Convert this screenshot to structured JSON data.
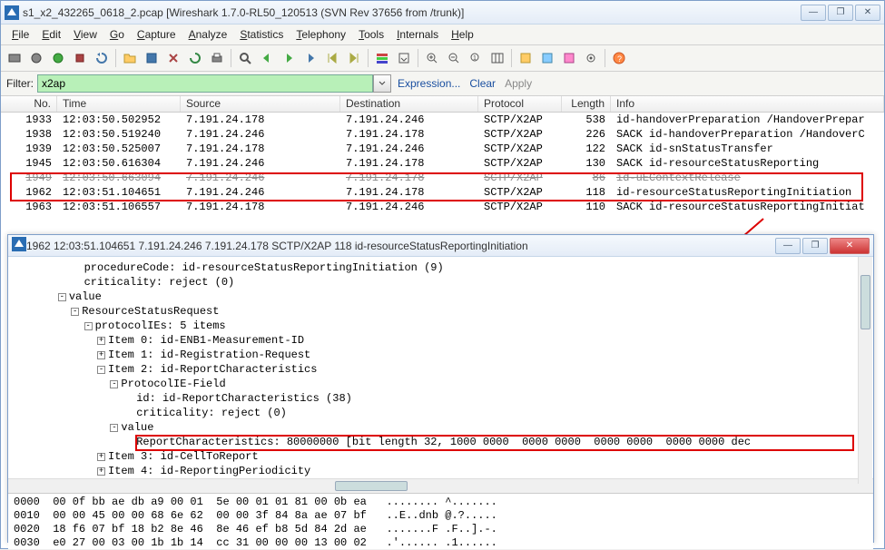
{
  "window": {
    "title": "s1_x2_432265_0618_2.pcap   [Wireshark 1.7.0-RL50_120513   (SVN Rev 37656 from /trunk)]"
  },
  "menu": {
    "items": [
      "File",
      "Edit",
      "View",
      "Go",
      "Capture",
      "Analyze",
      "Statistics",
      "Telephony",
      "Tools",
      "Internals",
      "Help"
    ]
  },
  "filter": {
    "label": "Filter:",
    "value": "x2ap",
    "expression": "Expression...",
    "clear": "Clear",
    "apply": "Apply"
  },
  "columns": {
    "no": "No.",
    "time": "Time",
    "source": "Source",
    "destination": "Destination",
    "protocol": "Protocol",
    "length": "Length",
    "info": "Info"
  },
  "packets": [
    {
      "no": "1933",
      "time": "12:03:50.502952",
      "src": "7.191.24.178",
      "dst": "7.191.24.246",
      "proto": "SCTP/X2AP",
      "len": "538",
      "info": "id-handoverPreparation /HandoverPrepar"
    },
    {
      "no": "1938",
      "time": "12:03:50.519240",
      "src": "7.191.24.246",
      "dst": "7.191.24.178",
      "proto": "SCTP/X2AP",
      "len": "226",
      "info": "SACK id-handoverPreparation /HandoverC"
    },
    {
      "no": "1939",
      "time": "12:03:50.525007",
      "src": "7.191.24.178",
      "dst": "7.191.24.246",
      "proto": "SCTP/X2AP",
      "len": "122",
      "info": "SACK id-snStatusTransfer"
    },
    {
      "no": "1945",
      "time": "12:03:50.616304",
      "src": "7.191.24.246",
      "dst": "7.191.24.178",
      "proto": "SCTP/X2AP",
      "len": "130",
      "info": "SACK id-resourceStatusReporting"
    },
    {
      "no": "1949",
      "time": "12:03:50.663094",
      "src": "7.191.24.246",
      "dst": "7.191.24.178",
      "proto": "SCTP/X2AP",
      "len": "86",
      "info": "id-uEContextRelease",
      "strike": true
    },
    {
      "no": "1962",
      "time": "12:03:51.104651",
      "src": "7.191.24.246",
      "dst": "7.191.24.178",
      "proto": "SCTP/X2AP",
      "len": "118",
      "info": "id-resourceStatusReportingInitiation"
    },
    {
      "no": "1963",
      "time": "12:03:51.106557",
      "src": "7.191.24.178",
      "dst": "7.191.24.246",
      "proto": "SCTP/X2AP",
      "len": "110",
      "info": "SACK id-resourceStatusReportingInitiat"
    }
  ],
  "detail": {
    "title": "1962 12:03:51.104651 7.191.24.246 7.191.24.178 SCTP/X2AP 118 id-resourceStatusReportingInitiation",
    "lines": [
      {
        "indent": 3,
        "text": "procedureCode: id-resourceStatusReportingInitiation (9)"
      },
      {
        "indent": 3,
        "text": "criticality: reject (0)"
      },
      {
        "indent": 2,
        "box": "-",
        "text": "value"
      },
      {
        "indent": 3,
        "box": "-",
        "text": "ResourceStatusRequest"
      },
      {
        "indent": 4,
        "box": "-",
        "text": "protocolIEs: 5 items"
      },
      {
        "indent": 5,
        "box": "+",
        "text": "Item 0: id-ENB1-Measurement-ID"
      },
      {
        "indent": 5,
        "box": "+",
        "text": "Item 1: id-Registration-Request"
      },
      {
        "indent": 5,
        "box": "-",
        "text": "Item 2: id-ReportCharacteristics"
      },
      {
        "indent": 6,
        "box": "-",
        "text": "ProtocolIE-Field"
      },
      {
        "indent": 7,
        "text": "id: id-ReportCharacteristics (38)"
      },
      {
        "indent": 7,
        "text": "criticality: reject (0)"
      },
      {
        "indent": 6,
        "box": "-",
        "text": "value"
      },
      {
        "indent": 7,
        "text": "ReportCharacteristics: 80000000 [bit length 32, 1000 0000  0000 0000  0000 0000  0000 0000 dec"
      },
      {
        "indent": 5,
        "box": "+",
        "text": "Item 3: id-CellToReport"
      },
      {
        "indent": 5,
        "box": "+",
        "text": "Item 4: id-ReportingPeriodicity"
      }
    ]
  },
  "hex": {
    "lines": [
      "0000  00 0f bb ae db a9 00 01  5e 00 01 01 81 00 0b ea   ........ ^.......",
      "0010  00 00 45 00 00 68 6e 62  00 00 3f 84 8a ae 07 bf   ..E..dnb @.?.....",
      "0020  18 f6 07 bf 18 b2 8e 46  8e 46 ef b8 5d 84 2d ae   .......F .F..].-.",
      "0030  e0 27 00 03 00 1b 1b 14  cc 31 00 00 00 13 00 02   .'...... .1......"
    ]
  }
}
